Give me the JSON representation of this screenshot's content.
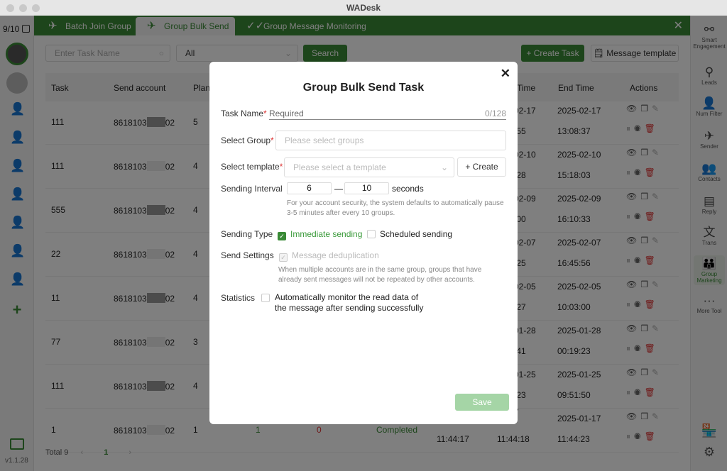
{
  "window": {
    "title": "WADesk"
  },
  "left_sidebar": {
    "account_count": "9/10",
    "version": "v1.1.28",
    "add": "+"
  },
  "tabs": [
    {
      "label": "Batch Join Group",
      "icon": "paper-plane-icon"
    },
    {
      "label": "Group Bulk Send",
      "icon": "paper-plane-icon",
      "active": true
    },
    {
      "label": "Group Message Monitoring",
      "icon": "double-check-icon"
    }
  ],
  "toolbar": {
    "search_placeholder": "Enter Task Name",
    "status_filter": "All",
    "search_label": "Search",
    "create_label": "+ Create Task",
    "template_label": "Message template"
  },
  "table": {
    "headers": [
      "Task",
      "Send account",
      "Plan",
      "Time",
      "End Time",
      "Actions"
    ],
    "rows": [
      {
        "task": "111",
        "account": "8618103",
        "account_end": "02",
        "plan": "5",
        "start_date": "02-17",
        "start_time": ":55",
        "end_date": "2025-02-17",
        "end_time": "13:08:37"
      },
      {
        "task": "111",
        "account": "8618103",
        "account_end": "02",
        "plan": "4",
        "start_date": "02-10",
        "start_time": ":28",
        "end_date": "2025-02-10",
        "end_time": "15:18:03"
      },
      {
        "task": "555",
        "account": "8618103",
        "account_end": "02",
        "plan": "4",
        "start_date": "02-09",
        "start_time": ":00",
        "end_date": "2025-02-09",
        "end_time": "16:10:33"
      },
      {
        "task": "22",
        "account": "8618103",
        "account_end": "02",
        "plan": "4",
        "start_date": "02-07",
        "start_time": ":25",
        "end_date": "2025-02-07",
        "end_time": "16:45:56"
      },
      {
        "task": "11",
        "account": "8618103",
        "account_end": "02",
        "plan": "4",
        "start_date": "02-05",
        "start_time": ":27",
        "end_date": "2025-02-05",
        "end_time": "10:03:00"
      },
      {
        "task": "77",
        "account": "8618103",
        "account_end": "02",
        "plan": "3",
        "start_date": "01-28",
        "start_time": ":41",
        "end_date": "2025-01-28",
        "end_time": "00:19:23"
      },
      {
        "task": "111",
        "account": "8618103",
        "account_end": "02",
        "plan": "4",
        "start_date": "01-25",
        "start_time": ":23",
        "end_date": "2025-01-25",
        "end_time": "09:51:50"
      },
      {
        "task": "1",
        "account": "8618103",
        "account_end": "02",
        "plan": "1",
        "success": "1",
        "failed": "0",
        "status": "Completed",
        "created_time": "11:44:17",
        "start_date": "01-17",
        "start_time": "11:44:18",
        "end_date": "2025-01-17",
        "end_time": "11:44:23"
      }
    ]
  },
  "pagination": {
    "total": "Total 9",
    "current": "1",
    "prev": "‹",
    "next": "›"
  },
  "right_sidebar": [
    {
      "label": "Smart Engagement",
      "icon": "share-icon"
    },
    {
      "label": "Leads",
      "icon": "person-pin-icon"
    },
    {
      "label": "Num Filter",
      "icon": "user-search-icon"
    },
    {
      "label": "Sender",
      "icon": "paper-plane-icon"
    },
    {
      "label": "Contacts",
      "icon": "contacts-icon"
    },
    {
      "label": "Reply",
      "icon": "chat-icon"
    },
    {
      "label": "Trans",
      "icon": "translate-icon"
    },
    {
      "label": "Group Marketing",
      "icon": "group-icon",
      "active": true
    },
    {
      "label": "More Tool",
      "icon": "more-icon"
    }
  ],
  "modal": {
    "title": "Group Bulk Send Task",
    "task_name_label": "Task Name",
    "task_name_placeholder": "Required",
    "task_name_count": "0/128",
    "group_label": "Select Group",
    "group_placeholder": "Please select groups",
    "template_label": "Select template",
    "template_placeholder": "Please select a template",
    "create_label": "+ Create",
    "interval_label": "Sending Interval",
    "interval_min": "6",
    "interval_sep": "—",
    "interval_max": "10",
    "interval_unit": "seconds",
    "interval_hint": "For your account security, the system defaults to automatically pause 3-5 minutes after every 10 groups.",
    "type_label": "Sending Type",
    "type_immediate": "Immediate sending",
    "type_scheduled": "Scheduled sending",
    "settings_label": "Send Settings",
    "dedup_label": "Message deduplication",
    "dedup_hint": "When multiple accounts are in the same group, groups that have already sent messages will not be repeated by other accounts.",
    "stats_label": "Statistics",
    "stats_option": "Automatically monitor the read data of the message after sending successfully",
    "save_label": "Save"
  },
  "colors": {
    "brand": "#3a8a36",
    "danger": "#d33",
    "save_disabled": "#a5d5a6"
  }
}
